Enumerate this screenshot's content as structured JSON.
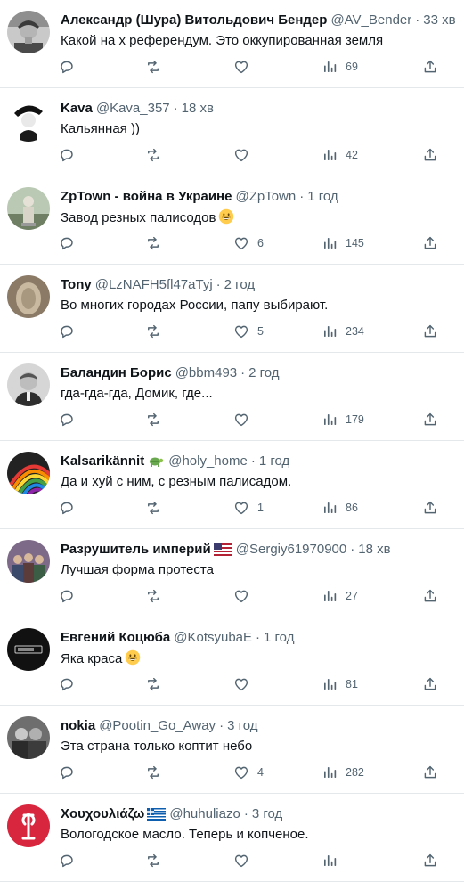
{
  "tweets": [
    {
      "name": "Александр (Шура) Витольдович Бендер",
      "handle": "@AV_Bender",
      "time": "33 хв",
      "text": "Какой на х референдум. Это оккупированная земля",
      "likes": "",
      "views": "69",
      "avatar": "bender",
      "emoji": ""
    },
    {
      "name": "Kava",
      "handle": "@Kava_357",
      "time": "18 хв",
      "text": "Кальянная ))",
      "likes": "",
      "views": "42",
      "avatar": "kava",
      "emoji": ""
    },
    {
      "name": "ZpTown - война в Украине",
      "handle": "@ZpTown",
      "time": "1 год",
      "text": "Завод резных палисодов",
      "likes": "6",
      "views": "145",
      "avatar": "zptown",
      "emoji": "grin"
    },
    {
      "name": "Tony",
      "handle": "@LzNAFH5fl47aTyj",
      "time": "2 год",
      "text": "Во многих городах России, папу выбирают.",
      "likes": "5",
      "views": "234",
      "avatar": "tony",
      "emoji": ""
    },
    {
      "name": "Баландин Борис",
      "handle": "@bbm493",
      "time": "2 год",
      "text": "гда-гда-гда, Домик, где...",
      "likes": "",
      "views": "179",
      "avatar": "boris",
      "emoji": ""
    },
    {
      "name": "Kalsarikännit",
      "handle": "@holy_home",
      "time": "1 год",
      "text": "Да и хуй с ним, с резным палисадом.",
      "likes": "1",
      "views": "86",
      "avatar": "rainbow",
      "emoji": "",
      "badge": "turtle"
    },
    {
      "name": "Разрушитель империй",
      "handle": "@Sergiy61970900",
      "time": "18 хв",
      "text": "Лучшая форма протеста",
      "likes": "",
      "views": "27",
      "avatar": "group",
      "emoji": "",
      "badge": "us-flag"
    },
    {
      "name": "Евгений Коцюба",
      "handle": "@KotsyubaE",
      "time": "1 год",
      "text": "Яка краса",
      "likes": "",
      "views": "81",
      "avatar": "dark",
      "emoji": "grin"
    },
    {
      "name": "nokia",
      "handle": "@Pootin_Go_Away",
      "time": "3 год",
      "text": "Эта страна только коптит небо",
      "likes": "4",
      "views": "282",
      "avatar": "nokia",
      "emoji": ""
    },
    {
      "name": "Χουχουλιάζω",
      "handle": "@huhuliazo",
      "time": "3 год",
      "text": "Вологодское масло. Теперь и копченое.",
      "likes": "",
      "views": "",
      "avatar": "huhu",
      "emoji": "",
      "badge": "gr-flag"
    }
  ]
}
